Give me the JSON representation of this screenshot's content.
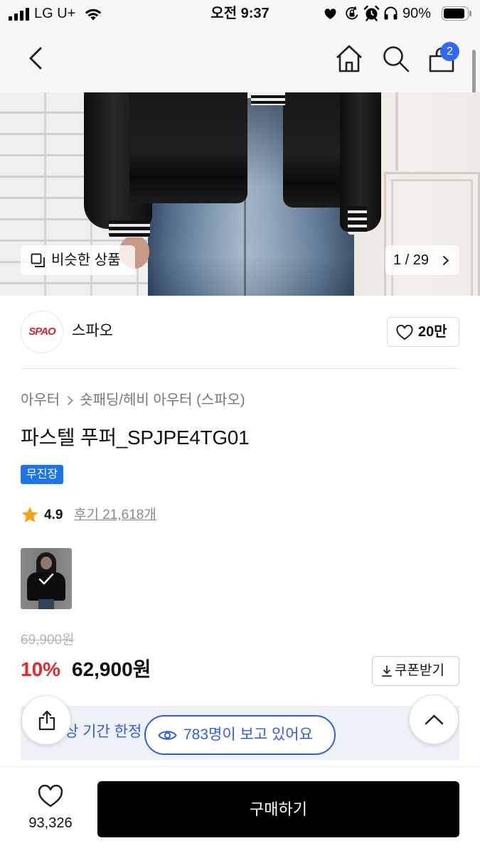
{
  "status_bar": {
    "carrier": "LG U+",
    "time": "오전 9:37",
    "battery_text": "90%",
    "battery_level": 0.9
  },
  "nav": {
    "cart_badge": "2",
    "icons": [
      "chevron-left-icon",
      "home-icon",
      "search-icon",
      "shopping-bag-icon"
    ]
  },
  "gallery": {
    "similar_label": "비슷한 상품",
    "counter": "1 / 29"
  },
  "brand": {
    "logo_text": "SPAO",
    "name": "스파오",
    "like_count": "20만"
  },
  "product": {
    "breadcrumb": [
      "아우터",
      "숏패딩/헤비 아우터 (스파오)"
    ],
    "title": "파스텔 푸퍼_SPJPE4TG01",
    "badge": "무진장",
    "rating": "4.9",
    "reviews": "후기 21,618개",
    "original_price": "69,900원",
    "discount_rate": "10%",
    "sale_price": "62,900원",
    "coupon_label": "쿠폰받기"
  },
  "promo": {
    "banner_text": "상 기간 한정",
    "viewers_text": "783명이 보고 있어요"
  },
  "bottom_bar": {
    "like_count": "93,326",
    "buy_label": "구매하기"
  },
  "theme": {
    "accent": "#2f5ee0",
    "cart_badge": "#3169f5",
    "badge_bg": "#1c74e9",
    "discount": "#e8262b",
    "rating_star": "#f7a21b",
    "logo_red": "#d3262e",
    "buy_button": "#000000"
  }
}
